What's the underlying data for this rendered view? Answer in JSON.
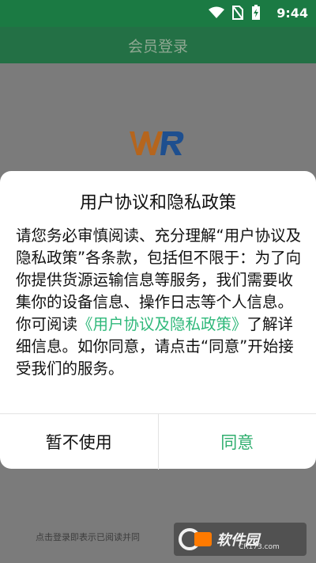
{
  "status_bar": {
    "time": "9:44"
  },
  "app_bar": {
    "title": "会员登录"
  },
  "dialog": {
    "title": "用户协议和隐私政策",
    "body_line1": "请您务必审慎阅读、充分理解“用户协议及隐私政策”各条款，包括但不限于：为了向你提供货源运输信息等服务，我们需要收集你的设备信息、操作日志等个人信息。",
    "body_prefix": "你可阅读",
    "body_link": "《用户协议及隐私政策》",
    "body_suffix": "了解详细信息。如你同意，请点击“同意”开始接受我们的服务。",
    "cancel_label": "暂不使用",
    "agree_label": "同意"
  },
  "footer": {
    "text": "点击登录即表示已阅读并同"
  },
  "watermark": {
    "text": "软件园",
    "sub": "CR173.com"
  },
  "colors": {
    "brand_green": "#1b7a43",
    "link_green": "#2fb87a"
  }
}
